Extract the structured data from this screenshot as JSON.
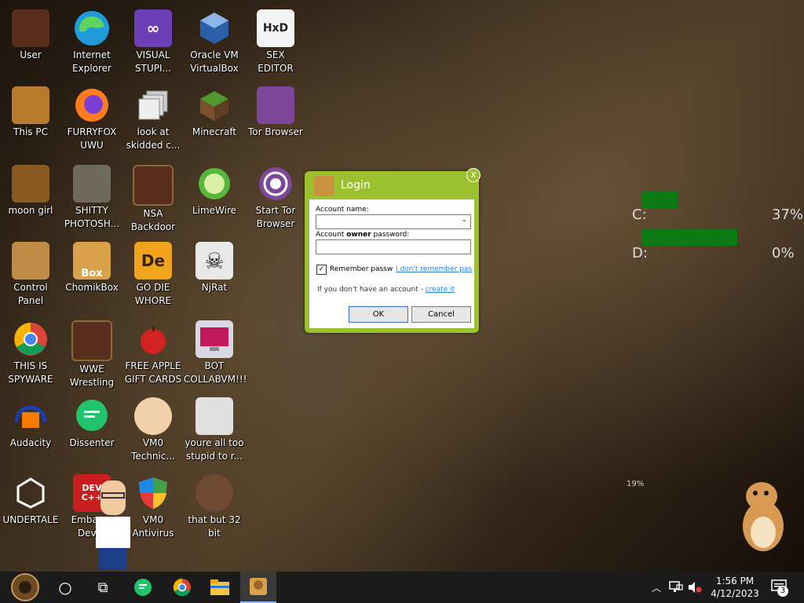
{
  "desktop": {
    "icons": [
      {
        "label": "User"
      },
      {
        "label": "Internet\nExplorer"
      },
      {
        "label": "VISUAL\nSTUPI..."
      },
      {
        "label": "Oracle VM\nVirtualBox"
      },
      {
        "label": "SEX\nEDITOR"
      },
      {
        "label": "This PC"
      },
      {
        "label": "FURRYFOX\nUWU"
      },
      {
        "label": "look at\nskidded c..."
      },
      {
        "label": "Minecraft"
      },
      {
        "label": "Tor Browser"
      },
      {
        "label": "moon girl"
      },
      {
        "label": "SHITTY\nPHOTOSH..."
      },
      {
        "label": "NSA\nBackdoor"
      },
      {
        "label": "LimeWire"
      },
      {
        "label": "Start Tor\nBrowser"
      },
      {
        "label": "Control Panel"
      },
      {
        "label": "ChomikBox"
      },
      {
        "label": "GO DIE\nWHORE"
      },
      {
        "label": "NjRat"
      },
      {
        "label": "THIS IS\nSPYWARE"
      },
      {
        "label": "WWE\nWrestling"
      },
      {
        "label": "FREE APPLE\nGIFT CARDS"
      },
      {
        "label": "BOT\nCOLLABVM!!!"
      },
      {
        "label": "Audacity"
      },
      {
        "label": "Dissenter"
      },
      {
        "label": "VM0\nTechnic..."
      },
      {
        "label": "youre all too\nstupid to r..."
      },
      {
        "label": "UNDERTALE"
      },
      {
        "label": "Embarca\nDev-C"
      },
      {
        "label": "VM0\nAntivirus"
      },
      {
        "label": "that but 32\nbit"
      }
    ],
    "icon_glyphs": {
      "box_text": "Box",
      "de_text": "De",
      "dev_text": "DEV\nC++",
      "hxd_text": "HxD"
    }
  },
  "login": {
    "title": "Login",
    "close": "x",
    "account_name_label": "Account name:",
    "account_name_value": "",
    "password_label_pre": "Account ",
    "password_label_bold": "owner",
    "password_label_post": " password:",
    "password_value": "",
    "remember_checked": true,
    "remember_label": "Remember passw",
    "forgot_link": "I don't remember pas",
    "no_account_text": "If you don't have an account - ",
    "create_link": "create it",
    "ok_label": "OK",
    "cancel_label": "Cancel"
  },
  "drive_monitor": {
    "drives": [
      {
        "label": "C:",
        "percent_text": "37%",
        "fill": 0.37
      },
      {
        "label": "D:",
        "percent_text": "0%",
        "fill": 0.97
      }
    ],
    "small_text": "19%"
  },
  "taskbar": {
    "pinned": [
      "start",
      "search",
      "task-view",
      "dissenter",
      "chrome",
      "file-explorer",
      "chomikbox"
    ],
    "clock_time": "1:56 PM",
    "clock_date": "4/12/2023",
    "notification_count": "3"
  },
  "colors": {
    "dialog_green": "#9bc12e",
    "bar_green": "#0c7a12",
    "taskbar": "#1b1b1b",
    "link": "#2a7fd8"
  }
}
